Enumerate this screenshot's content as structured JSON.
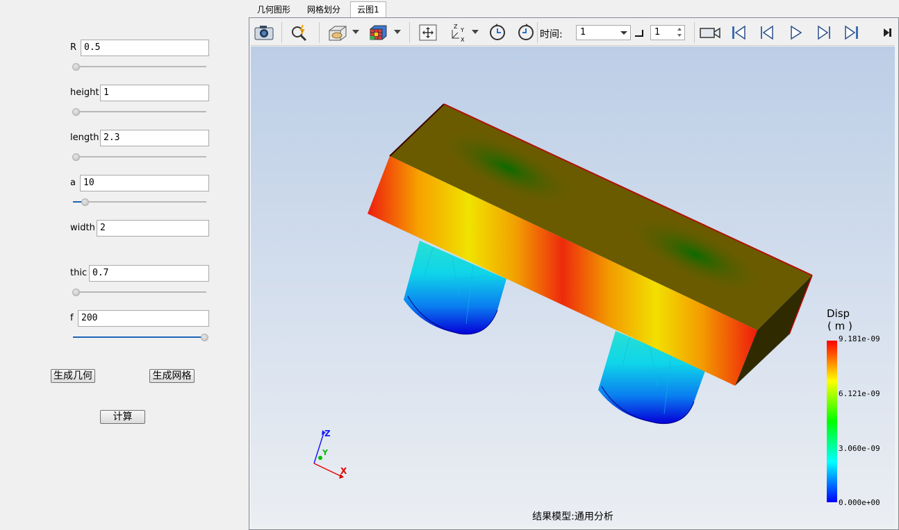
{
  "parameters": [
    {
      "label": "R",
      "value": "0.5",
      "slider_fraction": 0.0
    },
    {
      "label": "height",
      "value": "1",
      "slider_fraction": 0.0
    },
    {
      "label": "length",
      "value": "2.3",
      "slider_fraction": 0.0
    },
    {
      "label": "a",
      "value": "10",
      "slider_fraction": 0.09
    },
    {
      "label": "width",
      "value": "2",
      "slider_fraction": null
    },
    {
      "label": "thic",
      "value": "0.7",
      "slider_fraction": 0.0
    },
    {
      "label": "f",
      "value": "200",
      "slider_fraction": 1.0
    }
  ],
  "buttons": {
    "generate_geometry": "生成几何",
    "generate_mesh": "生成网格",
    "compute": "计算"
  },
  "tabs": [
    {
      "label": "几何图形",
      "active": false
    },
    {
      "label": "网格划分",
      "active": false
    },
    {
      "label": "云图1",
      "active": true
    }
  ],
  "toolbar": {
    "time_label": "时间:",
    "time_value": "1",
    "frame_value": "1",
    "icons": [
      "camera-icon",
      "zoom-icon",
      "display-mode-icon",
      "color-cube-icon",
      "fit-view-icon",
      "axis-orient-icon",
      "rotate-ccw-icon",
      "rotate-cw-icon",
      "record-icon",
      "first-frame-icon",
      "prev-frame-icon",
      "play-icon",
      "next-frame-icon",
      "last-frame-icon",
      "expand-icon"
    ]
  },
  "legend": {
    "title": "Disp",
    "unit": "( m )",
    "ticks": [
      "9.181e-09",
      "6.121e-09",
      "3.060e-09",
      "0.000e+00"
    ],
    "colors": [
      "#ff0000",
      "#ffff00",
      "#00ff00",
      "#00ffff",
      "#0000ff"
    ]
  },
  "axes": {
    "z": "Z",
    "y": "Y",
    "x": "X"
  },
  "model_label": "结果模型:通用分析"
}
